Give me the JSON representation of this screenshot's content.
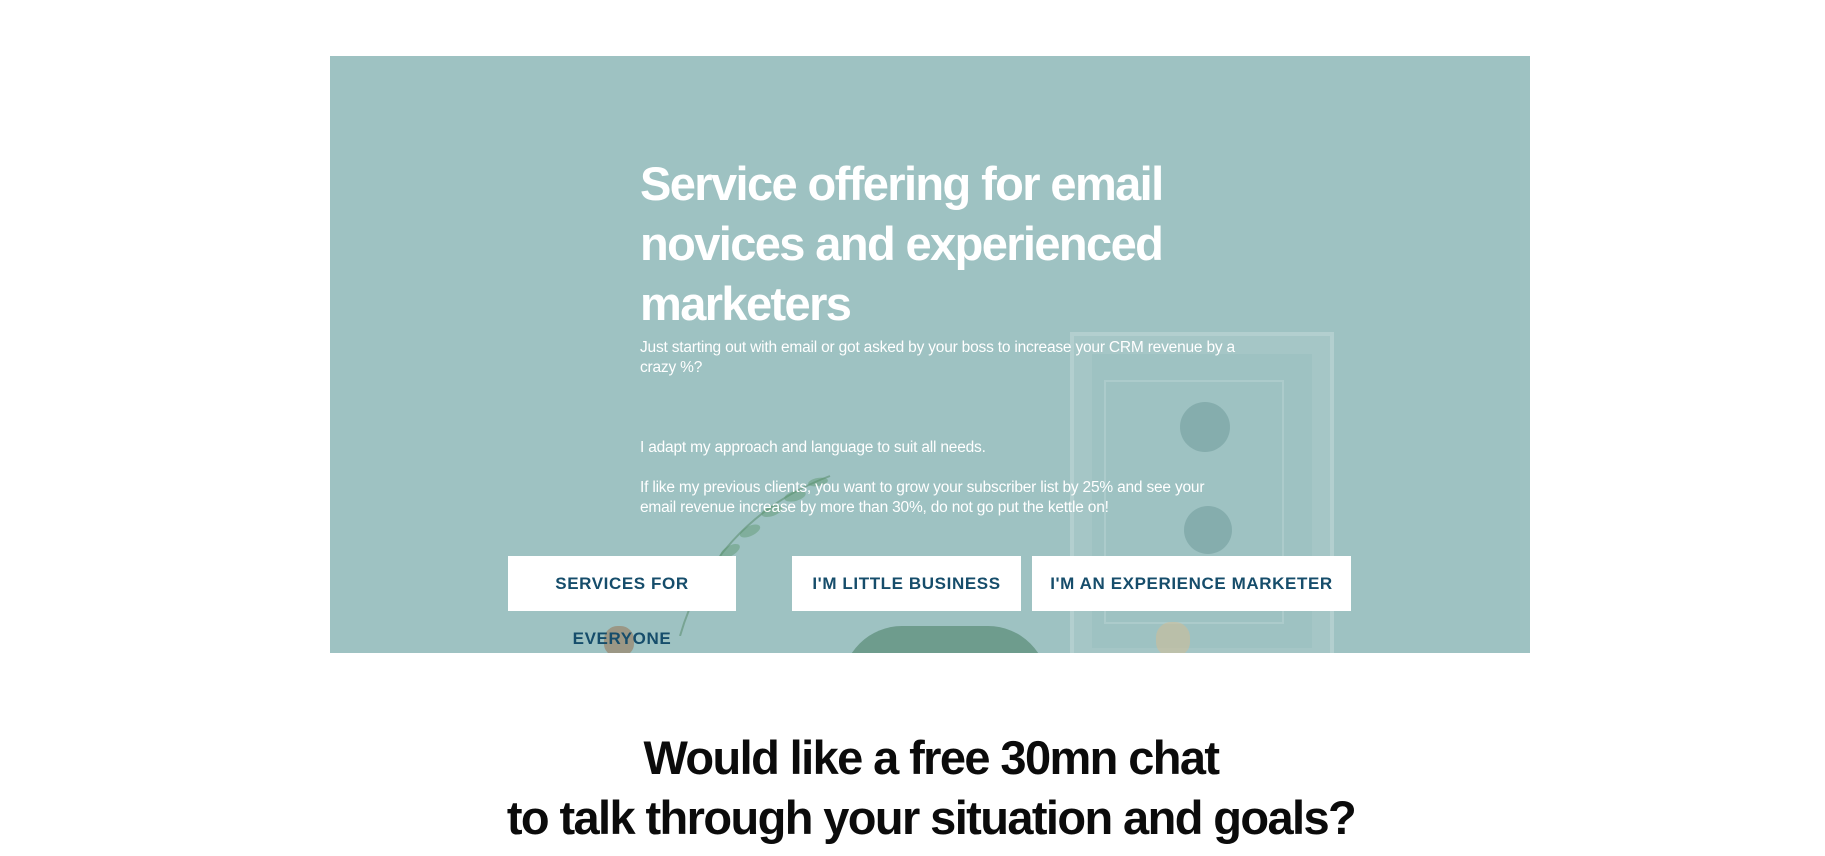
{
  "hero": {
    "title": "Service offering for email novices and experienced marketers",
    "paragraph_1": "Just starting out with email or got asked by your boss to increase your CRM revenue by a crazy %?",
    "paragraph_2": "I adapt my approach and language to suit all needs.",
    "paragraph_3": "If like my previous clients, you want to grow your subscriber list by 25% and see your email revenue increase by more than 30%, do not go put the kettle on!",
    "overlay_color": "#9ec2c2",
    "buttons": [
      {
        "label": "SERVICES FOR EVERYONE"
      },
      {
        "label": "I'M LITTLE BUSINESS"
      },
      {
        "label": "I'M AN EXPERIENCE MARKETER"
      }
    ],
    "button_text_color": "#164d6b"
  },
  "cta": {
    "line_1": "Would like a free 30mn chat",
    "line_2": "to talk through your situation and goals?"
  }
}
